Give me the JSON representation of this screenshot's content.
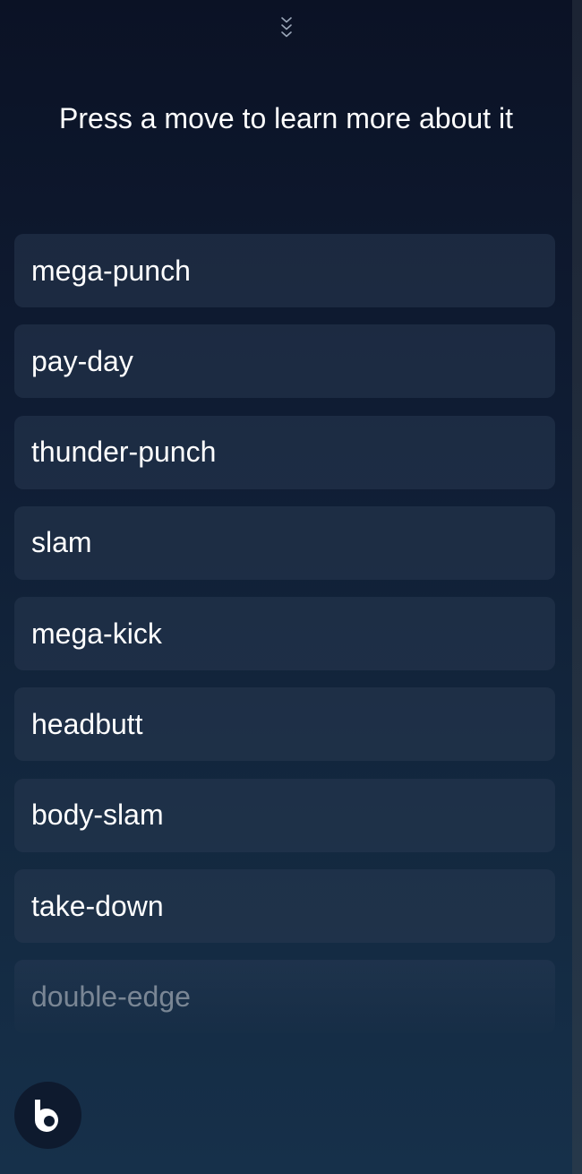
{
  "header": {
    "collapse_icon": "chevron-triple-down-icon",
    "prompt": "Press a move to learn more about it"
  },
  "moves": [
    {
      "label": "mega-punch"
    },
    {
      "label": "pay-day"
    },
    {
      "label": "thunder-punch"
    },
    {
      "label": "slam"
    },
    {
      "label": "mega-kick"
    },
    {
      "label": "headbutt"
    },
    {
      "label": "body-slam"
    },
    {
      "label": "take-down"
    },
    {
      "label": "double-edge"
    }
  ],
  "assistant": {
    "icon": "bixby-icon"
  },
  "colors": {
    "background_top": "#0b1225",
    "background_bottom": "#16304a",
    "item_background": "#1f2c42",
    "text": "#ffffff"
  }
}
